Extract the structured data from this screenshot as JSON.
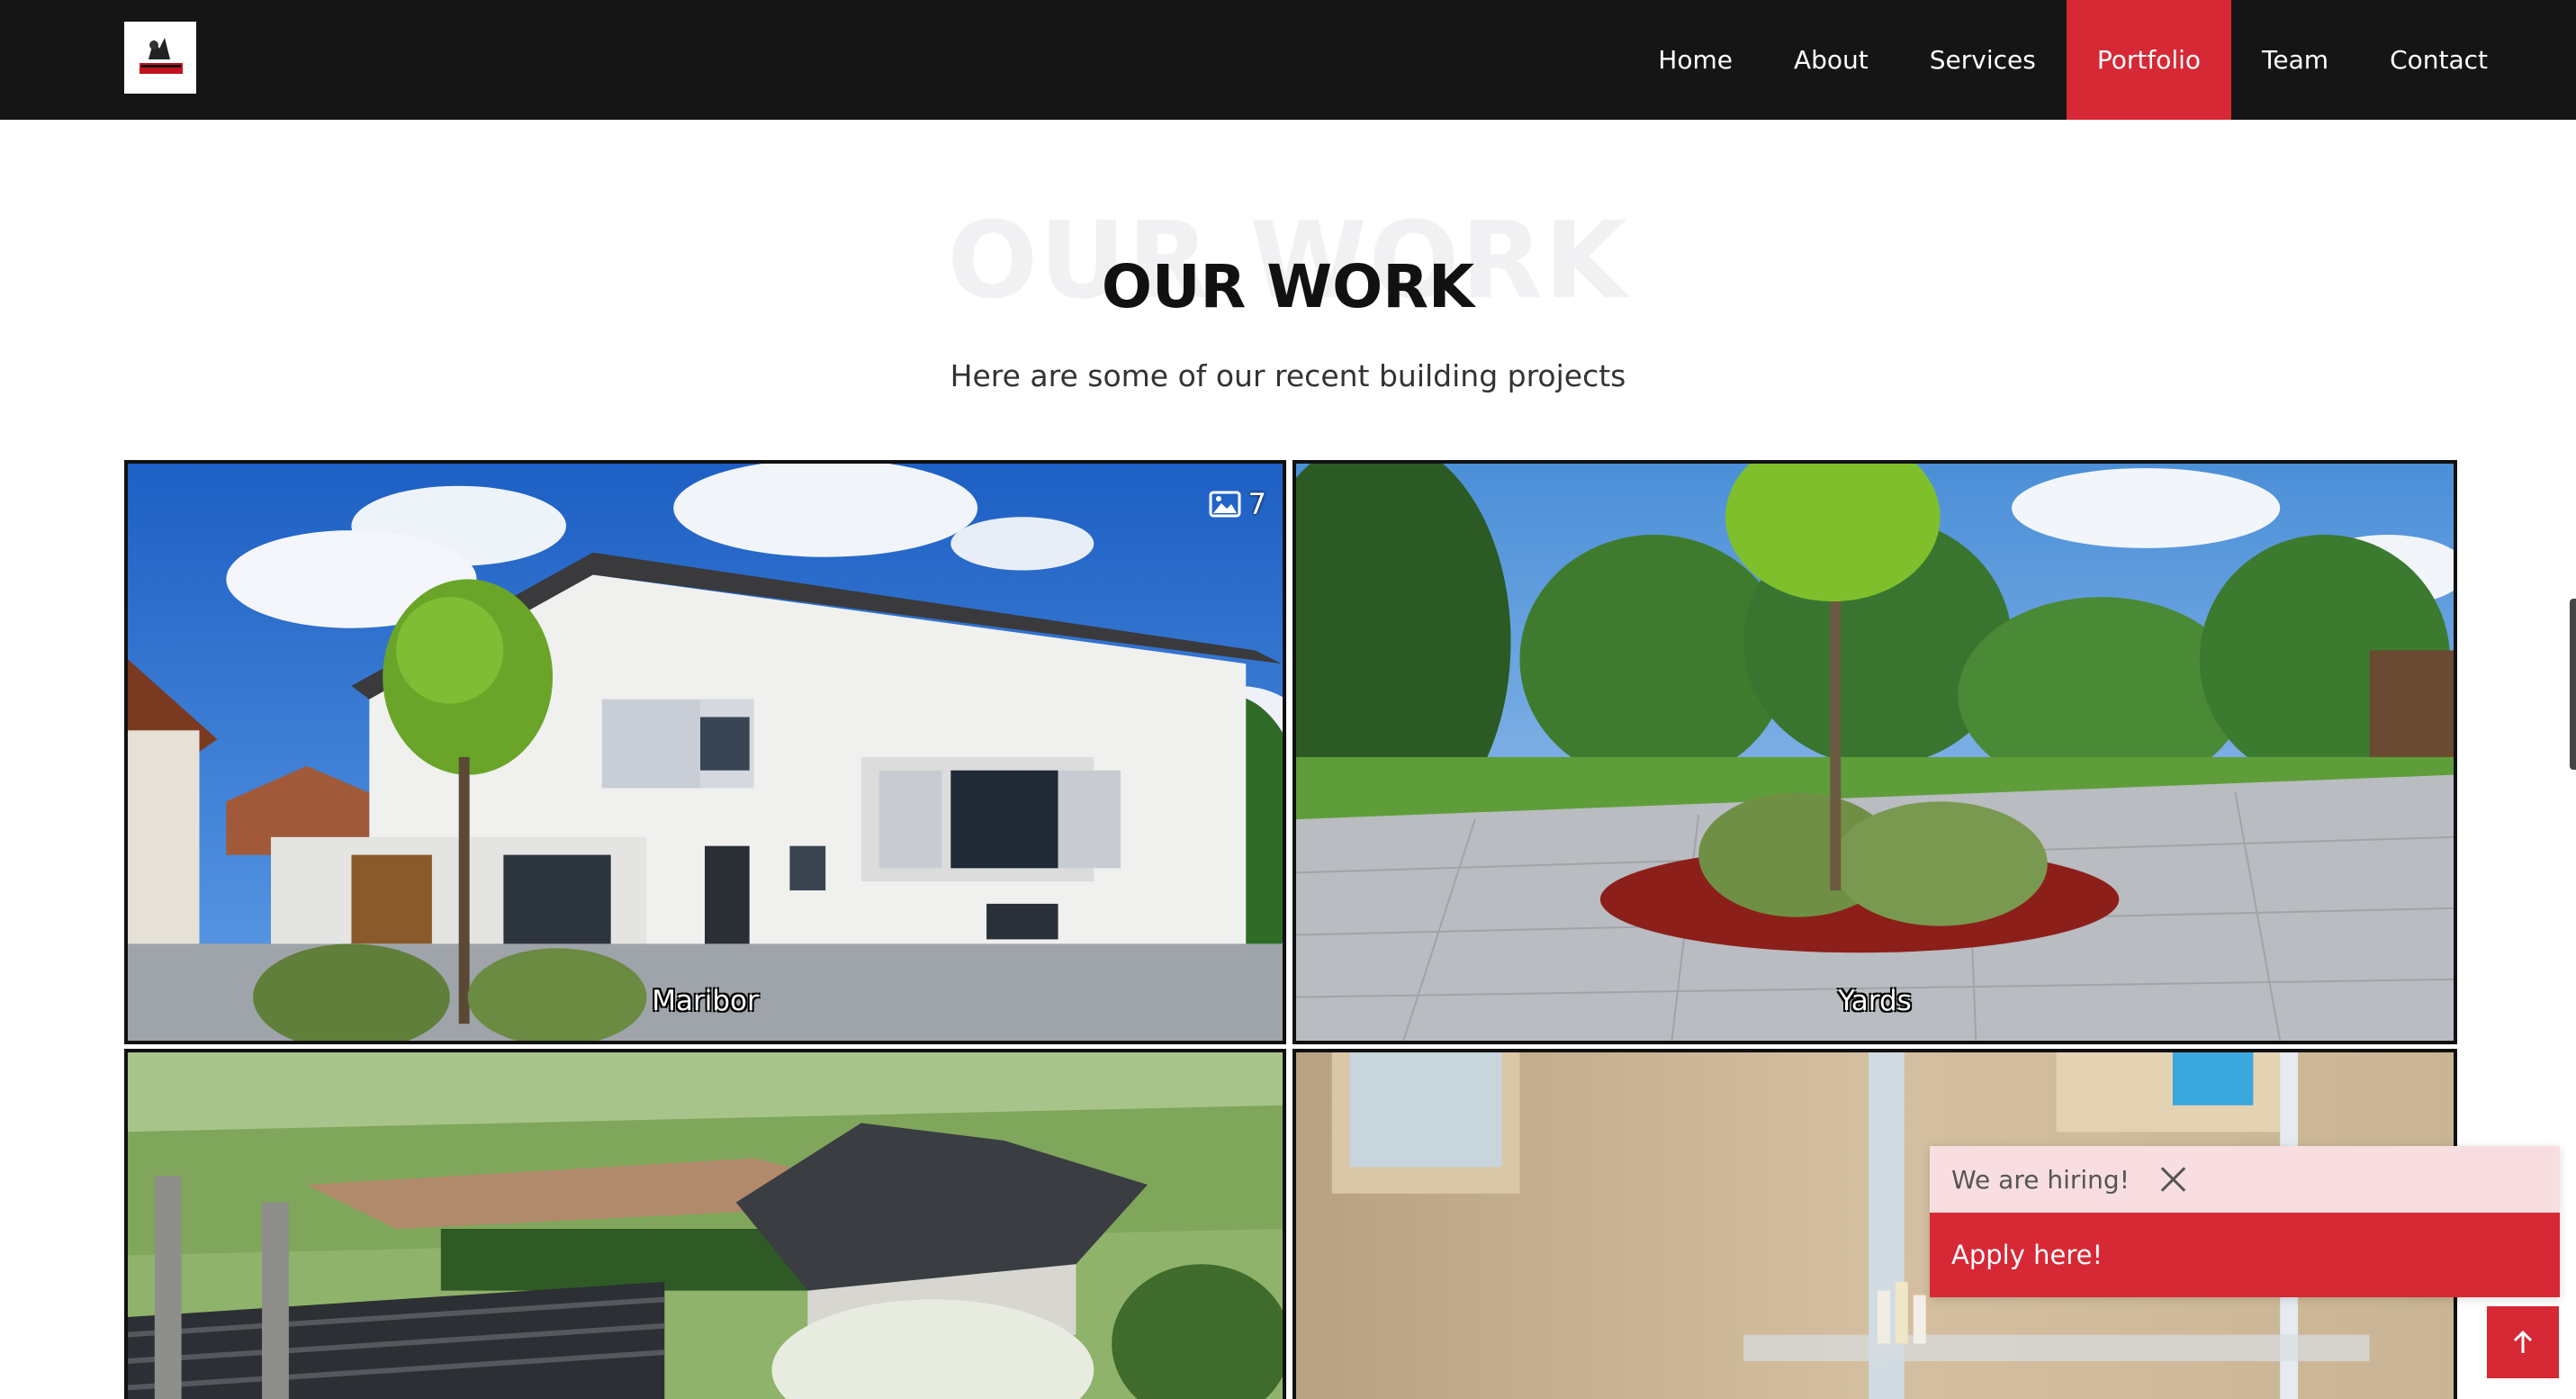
{
  "header": {
    "logo_alt": "company logo",
    "nav": [
      {
        "label": "Home"
      },
      {
        "label": "About"
      },
      {
        "label": "Services"
      },
      {
        "label": "Portfolio",
        "active": true
      },
      {
        "label": "Team"
      },
      {
        "label": "Contact"
      }
    ]
  },
  "section": {
    "title_bg": "OUR WORK",
    "title": "OUR WORK",
    "subtitle": "Here are some of our recent building projects"
  },
  "gallery": {
    "items": [
      {
        "caption": "Maribor",
        "photo_count": "7",
        "icon": "image-icon"
      },
      {
        "caption": "Yards"
      },
      {
        "caption": ""
      },
      {
        "caption": ""
      }
    ]
  },
  "hiring": {
    "text": "We are hiring!",
    "button": "Apply here!",
    "close_icon": "close-icon"
  },
  "back_to_top": {
    "icon": "arrow-up-icon"
  },
  "colors": {
    "header_bg": "#151515",
    "accent": "#d62835",
    "hiring_bg": "#f9dee1"
  }
}
